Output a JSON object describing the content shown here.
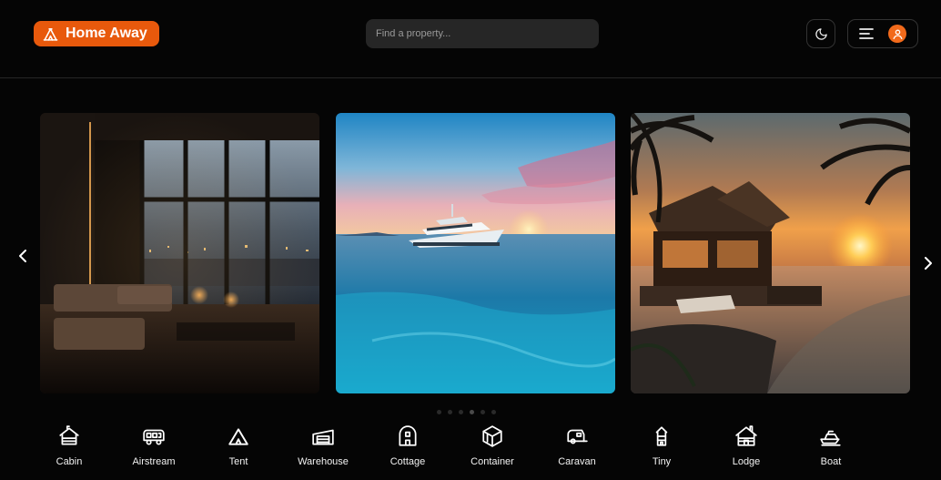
{
  "header": {
    "brand": "Home Away",
    "brand_icon": "tent-icon",
    "search_placeholder": "Find a property...",
    "theme_icon": "moon-icon",
    "menu_icon": "hamburger-icon",
    "avatar_icon": "user-icon",
    "accent_color": "#e8590c"
  },
  "carousel": {
    "slides": [
      {
        "subject": "luxury penthouse living room"
      },
      {
        "subject": "yacht at sea"
      },
      {
        "subject": "beach bungalow at sunset"
      }
    ],
    "dot_count": 6,
    "active_dot": 3
  },
  "categories": [
    {
      "label": "Cabin",
      "icon": "cabin-icon"
    },
    {
      "label": "Airstream",
      "icon": "airstream-icon"
    },
    {
      "label": "Tent",
      "icon": "tent-icon"
    },
    {
      "label": "Warehouse",
      "icon": "warehouse-icon"
    },
    {
      "label": "Cottage",
      "icon": "cottage-icon"
    },
    {
      "label": "Container",
      "icon": "container-icon"
    },
    {
      "label": "Caravan",
      "icon": "caravan-icon"
    },
    {
      "label": "Tiny",
      "icon": "tiny-house-icon"
    },
    {
      "label": "Lodge",
      "icon": "lodge-icon"
    },
    {
      "label": "Boat",
      "icon": "boat-icon"
    }
  ]
}
